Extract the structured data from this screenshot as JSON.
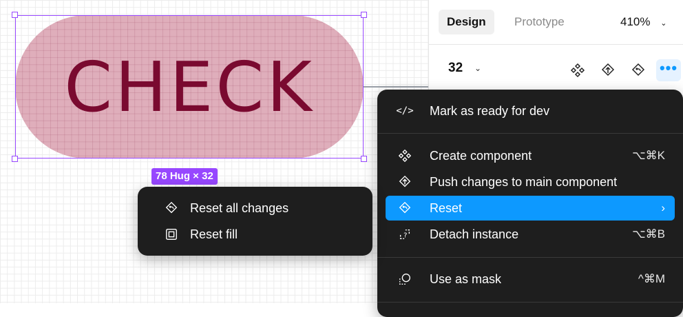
{
  "canvas": {
    "component_text": "CHECK",
    "dimension_badge": "78 Hug × 32"
  },
  "panel": {
    "tabs": [
      {
        "label": "Design"
      },
      {
        "label": "Prototype"
      }
    ],
    "zoom": "410%",
    "instance_value": "32"
  },
  "main_menu": {
    "items": [
      {
        "label": "Mark as ready for dev",
        "shortcut": "",
        "icon": "code-icon"
      },
      {
        "label": "Create component",
        "shortcut": "⌥⌘K",
        "icon": "component-icon"
      },
      {
        "label": "Push changes to main component",
        "shortcut": "",
        "icon": "push-changes-icon"
      },
      {
        "label": "Reset",
        "shortcut": "",
        "icon": "reset-icon",
        "active": true,
        "has_submenu": true
      },
      {
        "label": "Detach instance",
        "shortcut": "⌥⌘B",
        "icon": "detach-icon"
      },
      {
        "label": "Use as mask",
        "shortcut": "^⌘M",
        "icon": "mask-icon"
      }
    ]
  },
  "reset_submenu": {
    "items": [
      {
        "label": "Reset all changes",
        "icon": "reset-icon"
      },
      {
        "label": "Reset fill",
        "icon": "fill-icon"
      }
    ]
  },
  "colors": {
    "accent": "#0d99ff",
    "selection": "#9747ff",
    "pill_fill": "#dfaebb",
    "text_dark_red": "#7a0a30",
    "menu_bg": "#1e1e1e"
  }
}
